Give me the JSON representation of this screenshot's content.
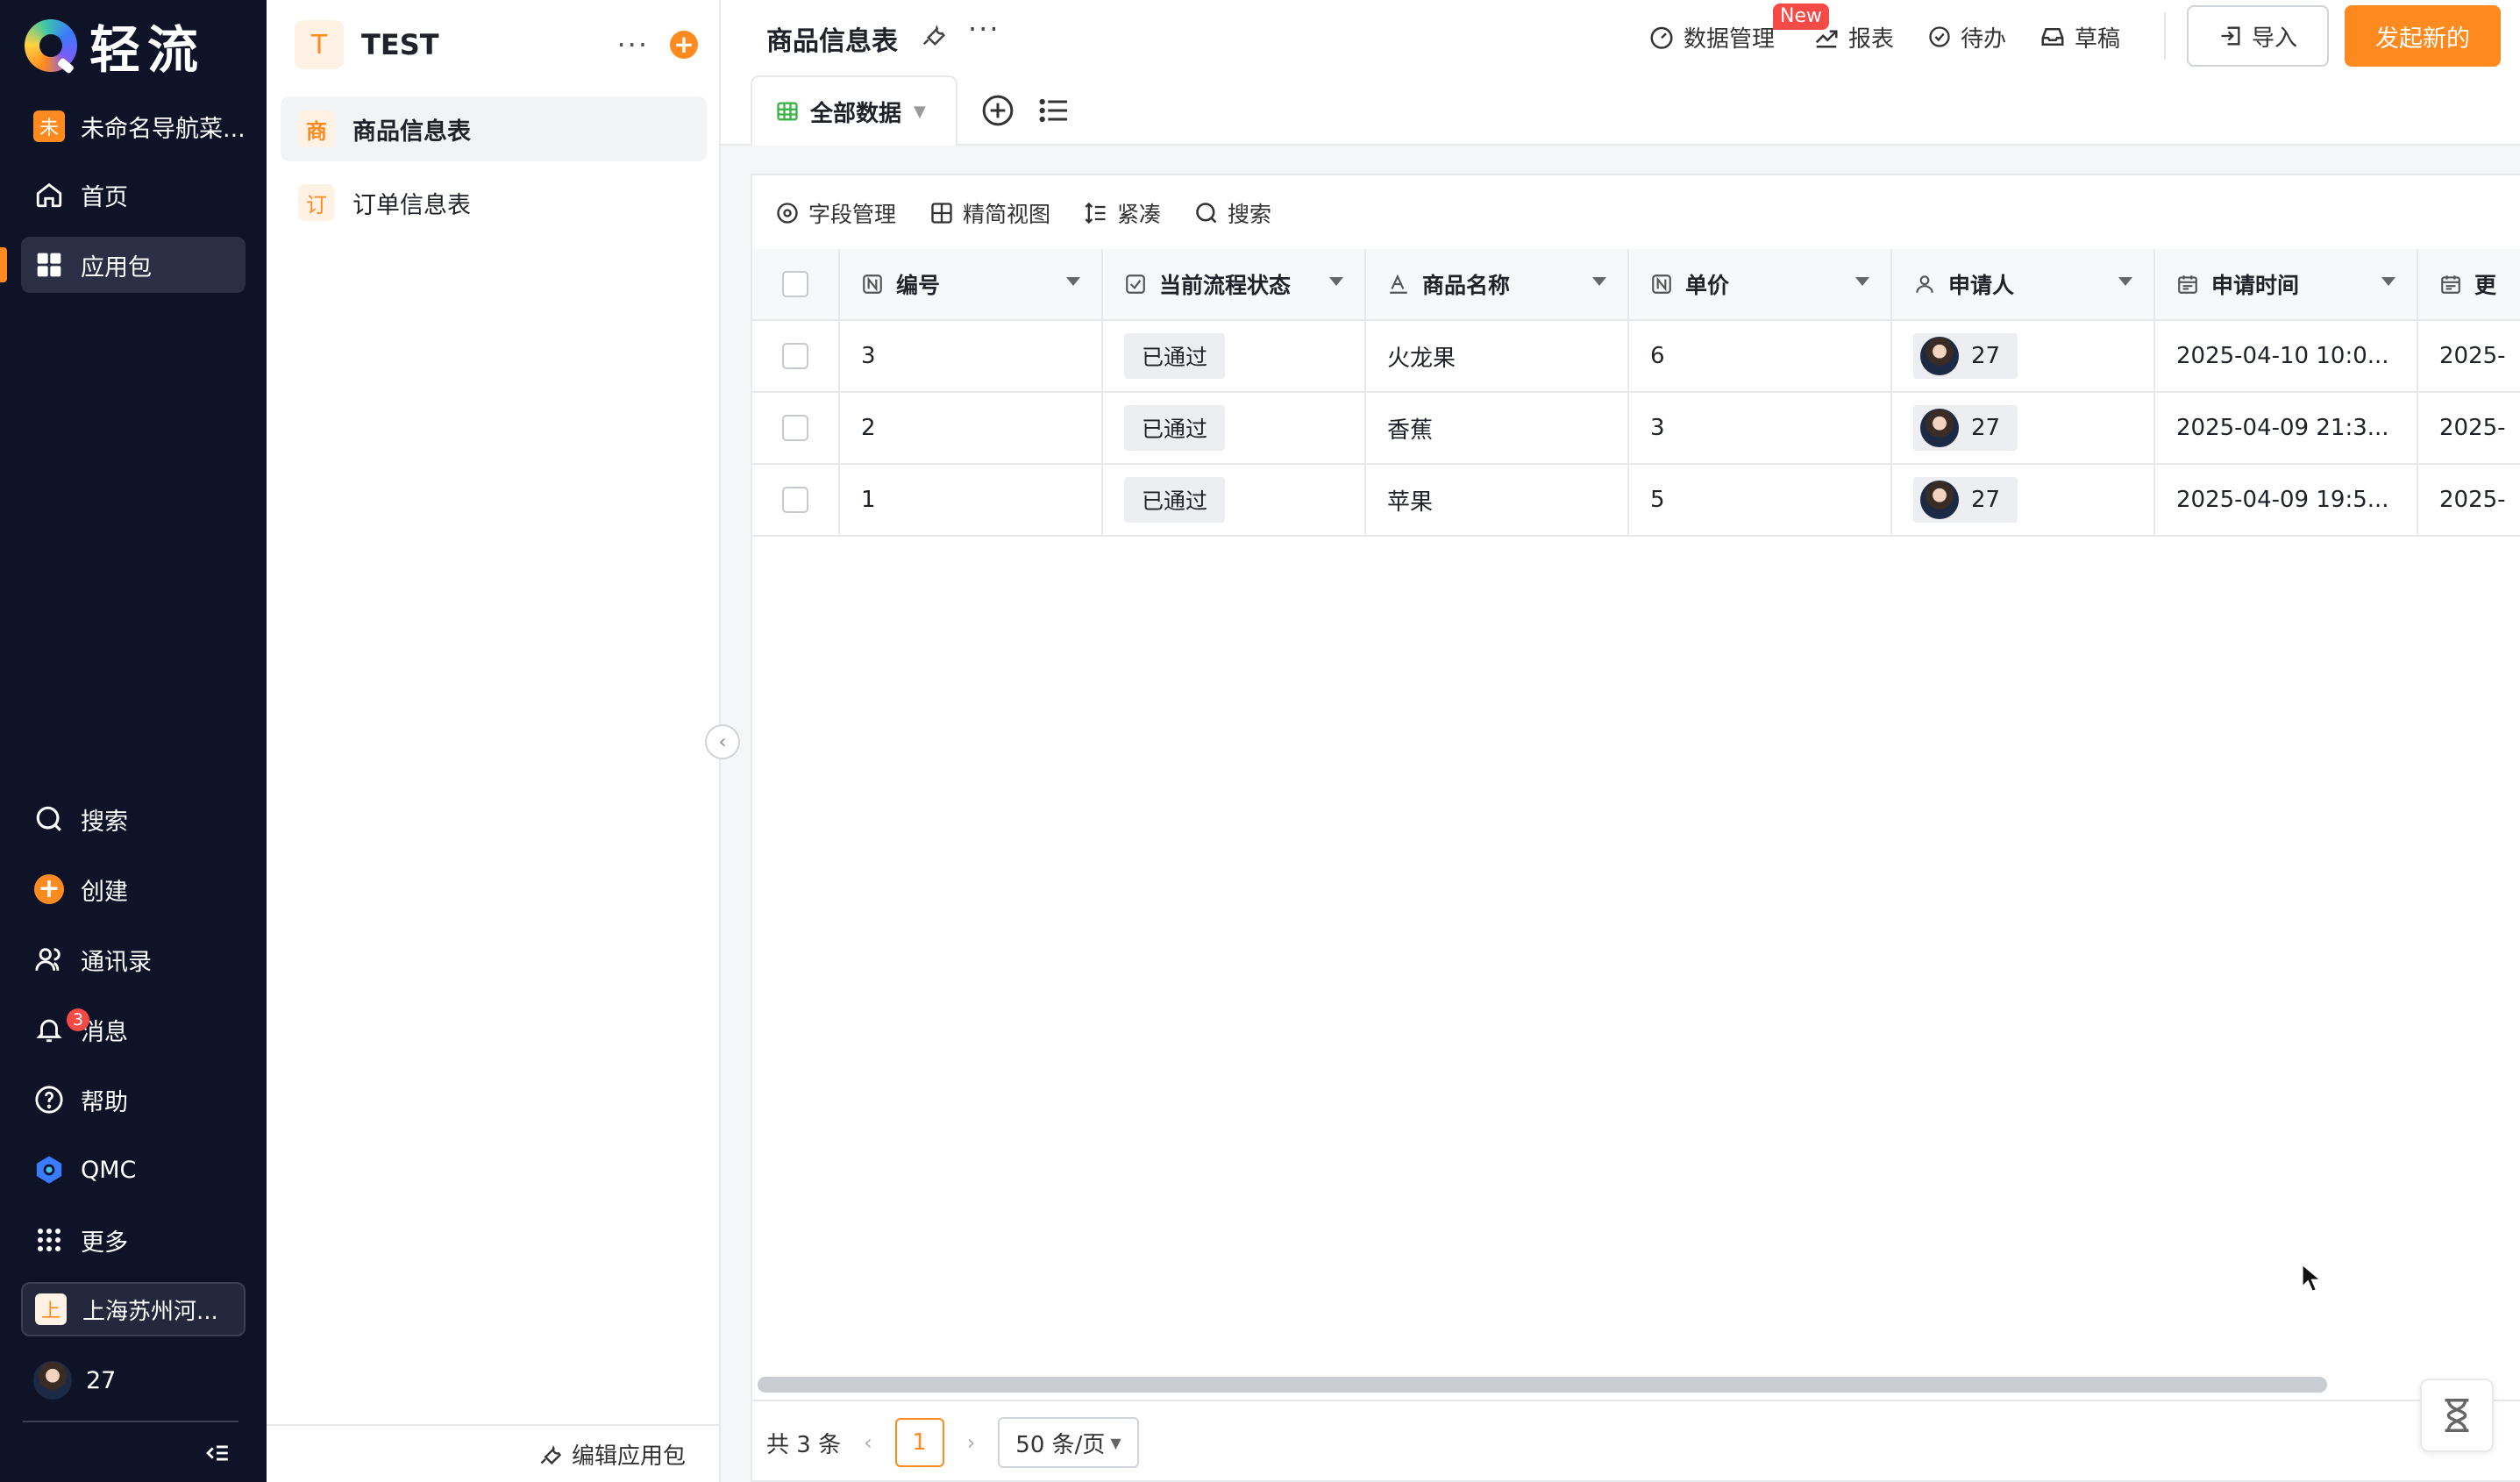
{
  "nav": {
    "brand": "轻流",
    "org_nav_badge": "未",
    "org_nav": "未命名导航菜...",
    "home": "首页",
    "apps": "应用包",
    "search": "搜索",
    "create": "创建",
    "contacts": "通讯录",
    "messages": "消息",
    "messages_badge": "3",
    "help": "帮助",
    "qmc": "QMC",
    "more": "更多",
    "org_switch_badge": "上",
    "org_switch": "上海苏州河...",
    "user": "27",
    "accent": "#ff8a1f"
  },
  "pkg": {
    "badge": "T",
    "title": "TEST",
    "more": "···",
    "items": [
      {
        "icon": "商",
        "label": "商品信息表"
      },
      {
        "icon": "订",
        "label": "订单信息表"
      }
    ],
    "edit": "编辑应用包"
  },
  "main": {
    "title": "商品信息表",
    "more": "···",
    "actions": {
      "data_mgmt": "数据管理",
      "new_badge": "New",
      "reports": "报表",
      "todo": "待办",
      "drafts": "草稿"
    },
    "import": "导入",
    "start_new": "发起新的",
    "view_tab": "全部数据",
    "toolbar": {
      "fields": "字段管理",
      "simple_view": "精简视图",
      "compact": "紧凑",
      "search": "搜索"
    }
  },
  "table": {
    "columns": [
      "编号",
      "当前流程状态",
      "商品名称",
      "单价",
      "申请人",
      "申请时间",
      "更"
    ],
    "rows": [
      {
        "id": "3",
        "status": "已通过",
        "name": "火龙果",
        "price": "6",
        "applicant": "27",
        "time": "2025-04-10 10:0...",
        "updated": "2025-"
      },
      {
        "id": "2",
        "status": "已通过",
        "name": "香蕉",
        "price": "3",
        "applicant": "27",
        "time": "2025-04-09 21:3...",
        "updated": "2025-"
      },
      {
        "id": "1",
        "status": "已通过",
        "name": "苹果",
        "price": "5",
        "applicant": "27",
        "time": "2025-04-09 19:5...",
        "updated": "2025-"
      }
    ]
  },
  "pager": {
    "total": "共 3 条",
    "current": "1",
    "page_size": "50 条/页"
  }
}
